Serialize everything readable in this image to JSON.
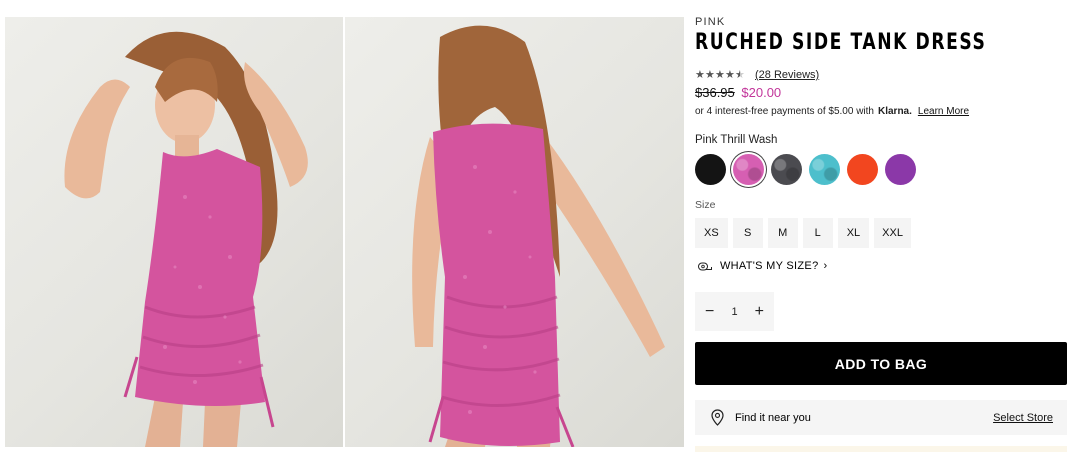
{
  "product": {
    "brand": "PINK",
    "title": "RUCHED SIDE TANK DRESS",
    "rating": 4.5,
    "reviews_link": "(28 Reviews)",
    "old_price": "$36.95",
    "new_price": "$20.00",
    "klarna_text": "or 4 interest-free payments of $5.00 with",
    "klarna_logo": "Klarna.",
    "learn_more": "Learn More"
  },
  "color": {
    "selected_label": "Pink Thrill Wash",
    "swatches": [
      {
        "name": "Black",
        "color": "#141414"
      },
      {
        "name": "Pink Thrill Wash",
        "color": "#d65fb2"
      },
      {
        "name": "Charcoal Wash",
        "color": "#4b4b50"
      },
      {
        "name": "Aqua Wash",
        "color": "#4dbfcc"
      },
      {
        "name": "Orange",
        "color": "#f2461f"
      },
      {
        "name": "Purple",
        "color": "#8b38a8"
      }
    ]
  },
  "size": {
    "label": "Size",
    "options": [
      "XS",
      "S",
      "M",
      "L",
      "XL",
      "XXL"
    ],
    "fit_link": "WHAT'S MY SIZE?"
  },
  "quantity": {
    "minus": "−",
    "value": "1",
    "plus": "+"
  },
  "actions": {
    "add_to_bag": "ADD TO BAG",
    "find_near": "Find it near you",
    "select_store": "Select Store"
  },
  "images": {
    "dress_color": "#d4549e",
    "skin_color": "#e9b99a",
    "hair_color": "#a0653a"
  }
}
